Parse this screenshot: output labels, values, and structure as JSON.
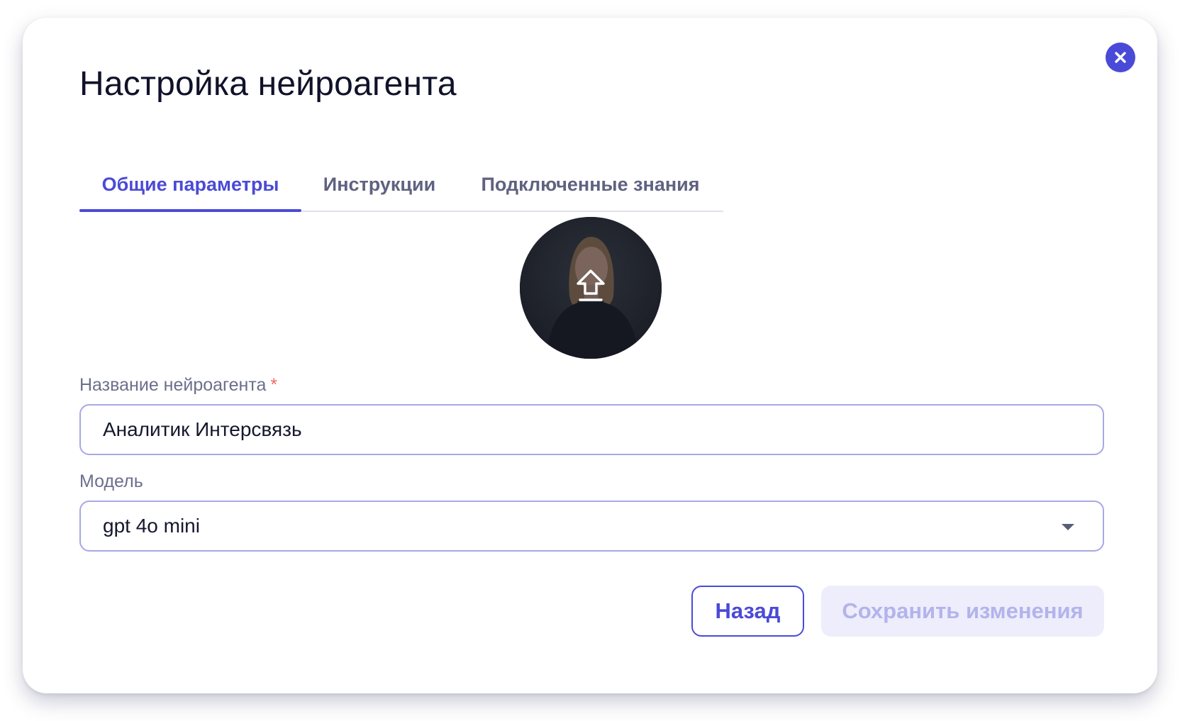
{
  "dialog": {
    "title": "Настройка нейроагента",
    "close_icon": "close-icon",
    "accent_color": "#4a4ad8"
  },
  "tabs": [
    {
      "label": "Общие параметры",
      "active": true
    },
    {
      "label": "Инструкции",
      "active": false
    },
    {
      "label": "Подключенные знания",
      "active": false
    }
  ],
  "avatar": {
    "icon": "upload-icon"
  },
  "form": {
    "name_label": "Название нейроагента",
    "required_mark": "*",
    "name_value": "Аналитик Интерсвязь",
    "model_label": "Модель",
    "model_value": "gpt 4o mini",
    "model_icon": "chevron-down-icon"
  },
  "actions": {
    "back_label": "Назад",
    "save_label": "Сохранить изменения"
  }
}
